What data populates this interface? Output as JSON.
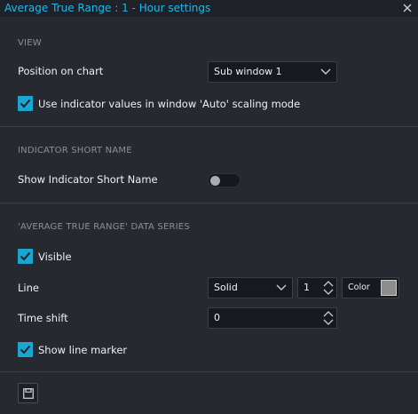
{
  "window": {
    "title": "Average True Range : 1 - Hour settings",
    "close_icon": "close-icon"
  },
  "view": {
    "heading": "VIEW",
    "position_label": "Position on chart",
    "position_value": "Sub window 1",
    "auto_scaling_label": "Use indicator values in window 'Auto' scaling mode",
    "auto_scaling_checked": true
  },
  "short_name": {
    "heading": "INDICATOR SHORT NAME",
    "show_label": "Show Indicator Short Name",
    "show_enabled": false
  },
  "series": {
    "heading": "'AVERAGE TRUE RANGE' DATA SERIES",
    "visible_label": "Visible",
    "visible_checked": true,
    "line_label": "Line",
    "line_style": "Solid",
    "line_width": "1",
    "color_label": "Color",
    "color_value": "#8d8d8d",
    "time_shift_label": "Time shift",
    "time_shift_value": "0",
    "marker_label": "Show line marker",
    "marker_checked": true
  },
  "footer": {
    "save_icon": "save-icon"
  },
  "colors": {
    "accent": "#1eb9ec",
    "checkbox": "#1aa6d0",
    "background": "#262a30",
    "input_bg": "#161a1f"
  }
}
